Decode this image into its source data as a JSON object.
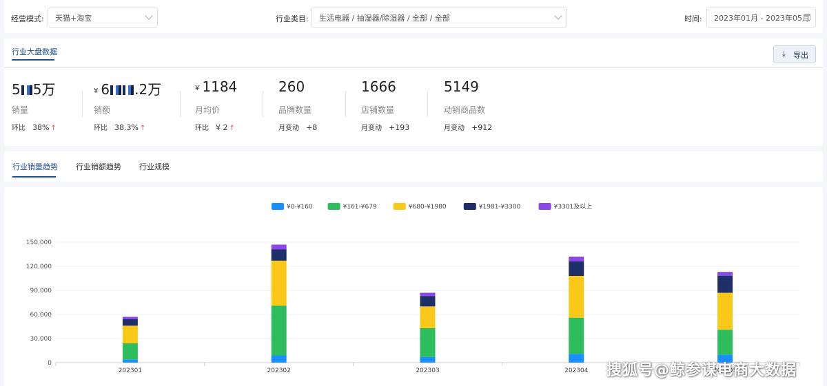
{
  "filters": {
    "mode_label": "经营模式:",
    "mode_value": "天猫+淘宝",
    "category_label": "行业类目:",
    "category_value": "生活电器 / 抽湿器/除湿器 / 全部 / 全部",
    "time_label": "时间:",
    "time_value": "2023年01月 - 2023年05月"
  },
  "overview": {
    "tab_label": "行业大盘数据",
    "export_label": "导出",
    "metrics": [
      {
        "value_a": "5",
        "value_b": "5万",
        "label": "销量",
        "sub_key": "环比",
        "sub_value": "38%",
        "arrow": "↑"
      },
      {
        "currency": "¥",
        "value_a": "6",
        "value_b": ".2万",
        "label": "销额",
        "sub_key": "环比",
        "sub_value": "38.3%",
        "arrow": "↑"
      },
      {
        "currency": "¥",
        "value": "1184",
        "label": "月均价",
        "sub_key": "环比",
        "sub_value": "¥ 2",
        "arrow": "↑"
      },
      {
        "value": "260",
        "label": "品牌数量",
        "sub_key": "月变动",
        "sub_value": "+8"
      },
      {
        "value": "1666",
        "label": "店铺数量",
        "sub_key": "月变动",
        "sub_value": "+193"
      },
      {
        "value": "5149",
        "label": "动销商品数",
        "sub_key": "月变动",
        "sub_value": "+912"
      }
    ]
  },
  "trend_tabs": [
    "行业销量趋势",
    "行业销额趋势",
    "行业规模"
  ],
  "chart_data": {
    "type": "bar",
    "stacked": true,
    "categories": [
      "202301",
      "202302",
      "202303",
      "202304",
      "202305"
    ],
    "series": [
      {
        "name": "¥0-¥160",
        "color": "#1890ff",
        "values": [
          4000,
          9000,
          7000,
          11000,
          10000
        ]
      },
      {
        "name": "¥161-¥679",
        "color": "#2ebd5c",
        "values": [
          20000,
          62000,
          36000,
          45000,
          31000
        ]
      },
      {
        "name": "¥680-¥1980",
        "color": "#fac818",
        "values": [
          22000,
          56000,
          27000,
          52000,
          46000
        ]
      },
      {
        "name": "¥1981-¥3300",
        "color": "#1e2f6a",
        "values": [
          8000,
          14000,
          13000,
          18000,
          21000
        ]
      },
      {
        "name": "¥3301及以上",
        "color": "#8b48e6",
        "values": [
          3000,
          6000,
          4000,
          6000,
          5000
        ]
      }
    ],
    "y_ticks": [
      "0",
      "30,000",
      "60,000",
      "90,000",
      "120,000",
      "150,000"
    ],
    "ylim": [
      0,
      150000
    ],
    "legend_position": "top-center",
    "grid": true
  },
  "watermark": "搜狐号@鲸参谋电商大数据"
}
